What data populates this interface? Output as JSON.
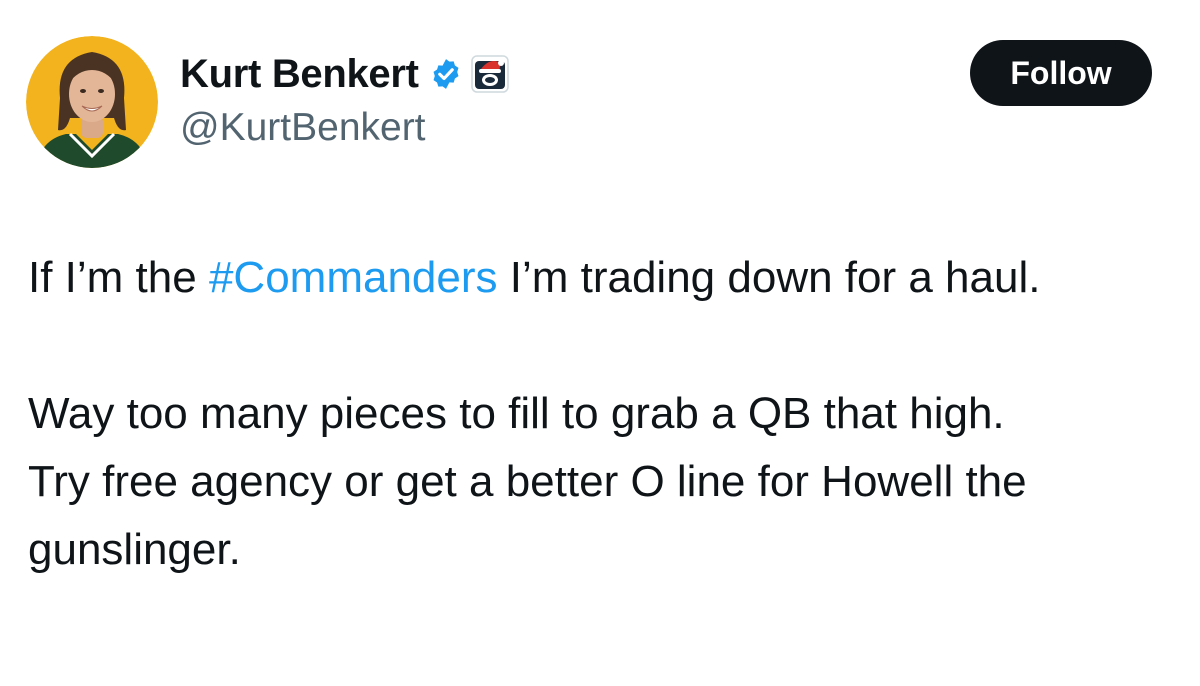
{
  "author": {
    "display_name": "Kurt Benkert",
    "handle": "@KurtBenkert",
    "avatar_icon": "profile-photo",
    "verified_icon": "verified-badge-icon",
    "affiliation_icon": "santa-hat-helmet-icon"
  },
  "follow_button": {
    "label": "Follow"
  },
  "tweet": {
    "para1_before": "If I’m the ",
    "para1_hashtag": "#Commanders",
    "para1_after": " I’m trading down for a haul.",
    "para2_line1": "Way too many pieces to fill to grab a QB that high.",
    "para2_line2": "Try free agency or get a better O line for Howell the gunslinger."
  },
  "colors": {
    "text": "#0f1419",
    "secondary_text": "#536471",
    "link": "#1d9bf0",
    "verified": "#1d9bf0",
    "follow_bg": "#0f1419",
    "follow_text": "#ffffff"
  }
}
